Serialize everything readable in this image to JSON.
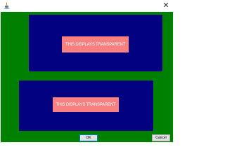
{
  "window": {
    "close_glyph": "✕",
    "icon": "java-app-icon"
  },
  "panels": {
    "top_label": "THIS DISPLAYS TRANSPARENT",
    "bottom_label": "THIS DISPLAYS TRANSPARENT"
  },
  "buttons": {
    "ok_label": "OK",
    "cancel_label": "Cancel"
  },
  "colors": {
    "background": "#008000",
    "panel": "#000080",
    "label": "#f88080",
    "label_text": "#ffffff"
  }
}
